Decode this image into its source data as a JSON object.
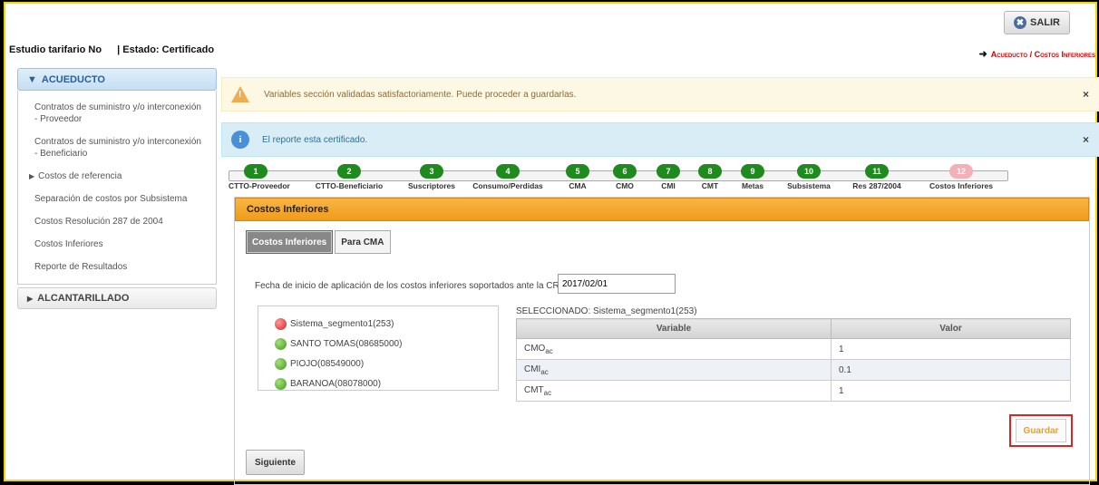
{
  "header": {
    "salir_label": "SALIR",
    "estudio_text": "Estudio tarifario No",
    "estado_text": "| Estado: Certificado",
    "breadcrumb": "Acueducto / Costos Inferiores"
  },
  "sidebar": {
    "acueducto_label": "ACUEDUCTO",
    "items": [
      {
        "label": "Contratos de suministro y/o interconexión - Proveedor"
      },
      {
        "label": "Contratos de suministro y/o interconexión - Beneficiario"
      },
      {
        "label": "Costos de referencia"
      },
      {
        "label": "Separación de costos por Subsistema"
      },
      {
        "label": "Costos Resolución 287 de 2004"
      },
      {
        "label": "Costos Inferiores"
      },
      {
        "label": "Reporte de Resultados"
      }
    ],
    "alcantarillado_label": "ALCANTARILLADO"
  },
  "alerts": {
    "warning_text": "Variables sección validadas satisfactoriamente. Puede proceder a guardarlas.",
    "info_text": "El reporte esta certificado.",
    "close_glyph": "×"
  },
  "wizard": {
    "steps": [
      {
        "num": "1",
        "label": "CTTO-Proveedor"
      },
      {
        "num": "2",
        "label": "CTTO-Beneficiario"
      },
      {
        "num": "3",
        "label": "Suscriptores"
      },
      {
        "num": "4",
        "label": "Consumo/Perdidas"
      },
      {
        "num": "5",
        "label": "CMA"
      },
      {
        "num": "6",
        "label": "CMO"
      },
      {
        "num": "7",
        "label": "CMI"
      },
      {
        "num": "8",
        "label": "CMT"
      },
      {
        "num": "9",
        "label": "Metas"
      },
      {
        "num": "10",
        "label": "Subsistema"
      },
      {
        "num": "11",
        "label": "Res 287/2004"
      },
      {
        "num": "12",
        "label": "Costos Inferiores"
      }
    ]
  },
  "panel": {
    "title": "Costos Inferiores",
    "tabs": [
      "Costos Inferiores",
      "Para CMA"
    ],
    "fecha_label": "Fecha de inicio de aplicación de los costos inferiores soportados ante la CRA",
    "fecha_value": "2017/02/01",
    "tree": [
      {
        "label": "Sistema_segmento1(253)",
        "status": "red"
      },
      {
        "label": "SANTO TOMAS(08685000)",
        "status": "green"
      },
      {
        "label": "PIOJO(08549000)",
        "status": "green"
      },
      {
        "label": "BARANOA(08078000)",
        "status": "green"
      }
    ],
    "selected_label": "SELECCIONADO: Sistema_segmento1(253)",
    "table": {
      "headers": [
        "Variable",
        "Valor"
      ],
      "rows": [
        {
          "var": "CMO",
          "sub": "ac",
          "value": "1"
        },
        {
          "var": "CMI",
          "sub": "ac",
          "value": "0.1"
        },
        {
          "var": "CMT",
          "sub": "ac",
          "value": "1"
        }
      ]
    },
    "guardar_label": "Guardar",
    "siguiente_label": "Siguiente"
  }
}
